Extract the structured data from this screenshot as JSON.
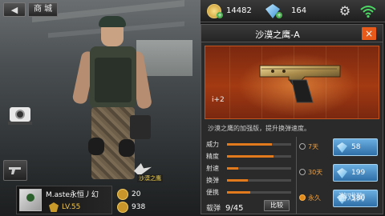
{
  "nav": {
    "back_icon": "back-arrow-icon",
    "title": "商 城"
  },
  "player": {
    "name": "M.aste永恒丿幻",
    "level": "LV.55",
    "stat1": "20",
    "stat2": "938"
  },
  "eagle_label": "沙漠之鹰",
  "currency": {
    "gold": "14482",
    "diamonds": "164"
  },
  "panel": {
    "title": "沙漠之鹰-A",
    "close_label": "×",
    "gun_level": "i+2",
    "description": "沙漠之鹰的加强版，提升换弹速度。",
    "stats": [
      {
        "label": "威力",
        "value": 0.7
      },
      {
        "label": "精度",
        "value": 0.72
      },
      {
        "label": "射速",
        "value": 0.18
      },
      {
        "label": "换弹",
        "value": 0.32
      },
      {
        "label": "便携",
        "value": 0.36
      }
    ],
    "ammo_label": "载弹",
    "ammo_value": "9/45",
    "compare_label": "比较",
    "prices": [
      {
        "duration": "7天",
        "amount": "58",
        "sale": "",
        "selected": false
      },
      {
        "duration": "30天",
        "amount": "199",
        "sale": "",
        "selected": false
      },
      {
        "duration": "永久",
        "amount": "580",
        "sale": "",
        "selected": true
      }
    ]
  },
  "watermark": "游戏狗",
  "colors": {
    "accent": "#e07a1c",
    "panel_bg": "#2a2a2a",
    "gun_bg": "#a33a12",
    "price_btn": "#2f6fa8"
  }
}
